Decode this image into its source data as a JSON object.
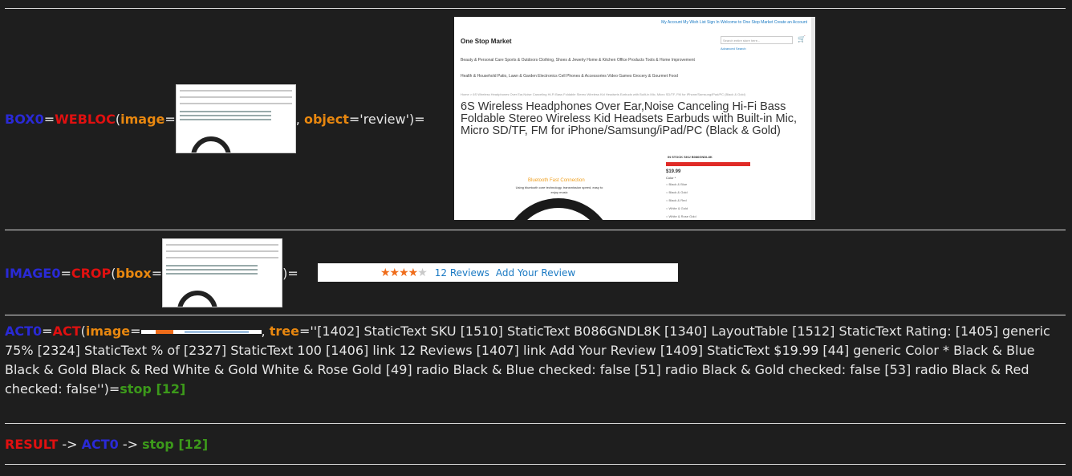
{
  "row1": {
    "var": "BOX0",
    "eq": "=",
    "func": "WEBLOC",
    "open": "(",
    "arg_image": "image",
    "arg_object": "object",
    "object_value": "'review'",
    "comma": ",",
    "close_eq": ")=",
    "webpage": {
      "top_links": "My Account   My Wish List   Sign In   Welcome to One Stop Market   Create an Account",
      "brand": "One Stop Market",
      "search_placeholder": "Search entire store here...",
      "advanced_search": "Advanced Search",
      "nav_row1": "Beauty & Personal Care      Sports & Outdoors      Clothing, Shoes & Jewelry      Home & Kitchen      Office Products      Tools & Home Improvement",
      "nav_row2": "Health & Household      Patio, Lawn & Garden      Electronics      Cell Phones & Accessories      Video Games      Grocery & Gourmet Food",
      "breadcrumb": "Home  >  6S Wireless Headphones Over Ear,Noise Canceling Hi-Fi Bass Foldable Stereo Wireless Kid Headsets Earbuds with Built-in Mic, Micro SD/TF, FM for iPhone/Samsung/iPad/PC (Black & Gold)",
      "product_title": "6S Wireless Headphones Over Ear,Noise Canceling Hi-Fi Bass Foldable Stereo Wireless Kid Headsets Earbuds with Built-in Mic, Micro SD/TF, FM for iPhone/Samsung/iPad/PC (Black & Gold)",
      "stock": "IN STOCK    SKU  B086GNDL8K",
      "price": "$19.99",
      "color_label": "Color *",
      "options": [
        "Black & Blue",
        "Black & Gold",
        "Black & Red",
        "White & Gold",
        "White & Rose Gold"
      ],
      "promo_title": "Bluetooth Fast Connection",
      "promo_sub": "Using bluetooth core technology, transmission speed, easy to enjoy music"
    }
  },
  "row2": {
    "var": "IMAGE0",
    "eq": "=",
    "func": "CROP",
    "open": "(",
    "arg_bbox": "bbox",
    "arg_eq": "=",
    "close_eq": ")=",
    "strip": {
      "rating_stars_on": 4,
      "rating_stars_total": 5,
      "reviews_link": "12  Reviews",
      "add_review_link": "Add Your Review"
    }
  },
  "row3": {
    "var": "ACT0",
    "eq": "=",
    "func": "ACT",
    "open": "(",
    "arg_image": "image",
    "arg_eq": "=",
    "comma": ",",
    "arg_tree": "tree",
    "tree_value": "=''[1402] StaticText SKU [1510] StaticText B086GNDL8K [1340] LayoutTable [1512] StaticText Rating: [1405] generic 75% [2324] StaticText % of [2327] StaticText 100 [1406] link 12  Reviews [1407] link Add Your Review [1409] StaticText $19.99 [44] generic Color * Black & Blue Black & Gold Black & Red White & Gold White & Rose Gold [49] radio Black & Blue checked: false [51] radio Black & Gold checked: false [53] radio Black & Red checked: false'')=",
    "result": "stop [12]"
  },
  "row4": {
    "label": "RESULT",
    "arrow1": " -> ",
    "ref": "ACT0",
    "arrow2": " -> ",
    "value": "stop [12]"
  }
}
